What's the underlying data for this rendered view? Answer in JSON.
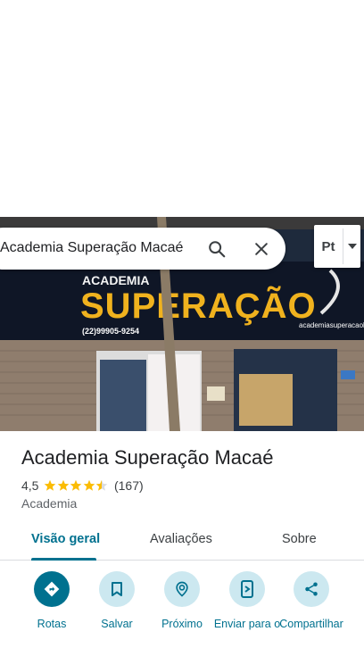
{
  "search": {
    "query": "Academia Superação Macaé"
  },
  "layer_button": {
    "label": "Pt"
  },
  "photo": {
    "sign_title": "ACADEMIA",
    "sign_brand": "SUPERAÇÃO",
    "sign_phone": "(22)99905-9254",
    "sign_social": "academiasuperacaolagor"
  },
  "place": {
    "name": "Academia Superação Macaé",
    "rating": "4,5",
    "rating_value": 4.5,
    "reviews": "(167)",
    "category": "Academia"
  },
  "tabs": [
    {
      "label": "Visão geral"
    },
    {
      "label": "Avaliações"
    },
    {
      "label": "Sobre"
    }
  ],
  "actions": [
    {
      "label": "Rotas"
    },
    {
      "label": "Salvar"
    },
    {
      "label": "Próximo"
    },
    {
      "label": "Enviar para o"
    },
    {
      "label": "Compartilhar"
    }
  ],
  "colors": {
    "accent": "#00718f",
    "accent_light": "#cce8f0",
    "star": "#fbbc04"
  }
}
